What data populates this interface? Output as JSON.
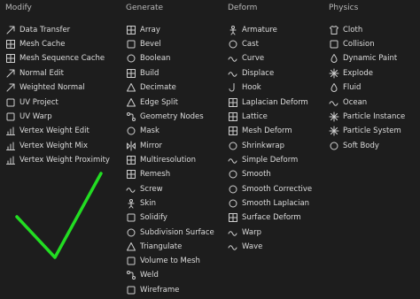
{
  "columns": [
    {
      "header": "Modify",
      "items": [
        {
          "label": "Data Transfer",
          "icon": "data-transfer-icon"
        },
        {
          "label": "Mesh Cache",
          "icon": "mesh-cache-icon"
        },
        {
          "label": "Mesh Sequence Cache",
          "icon": "mesh-sequence-cache-icon"
        },
        {
          "label": "Normal Edit",
          "icon": "normal-edit-icon"
        },
        {
          "label": "Weighted Normal",
          "icon": "weighted-normal-icon"
        },
        {
          "label": "UV Project",
          "icon": "uv-project-icon"
        },
        {
          "label": "UV Warp",
          "icon": "uv-warp-icon"
        },
        {
          "label": "Vertex Weight Edit",
          "icon": "vertex-weight-edit-icon"
        },
        {
          "label": "Vertex Weight Mix",
          "icon": "vertex-weight-mix-icon"
        },
        {
          "label": "Vertex Weight Proximity",
          "icon": "vertex-weight-proximity-icon"
        }
      ]
    },
    {
      "header": "Generate",
      "items": [
        {
          "label": "Array",
          "icon": "array-icon"
        },
        {
          "label": "Bevel",
          "icon": "bevel-icon"
        },
        {
          "label": "Boolean",
          "icon": "boolean-icon"
        },
        {
          "label": "Build",
          "icon": "build-icon"
        },
        {
          "label": "Decimate",
          "icon": "decimate-icon"
        },
        {
          "label": "Edge Split",
          "icon": "edge-split-icon"
        },
        {
          "label": "Geometry Nodes",
          "icon": "geometry-nodes-icon"
        },
        {
          "label": "Mask",
          "icon": "mask-icon"
        },
        {
          "label": "Mirror",
          "icon": "mirror-icon"
        },
        {
          "label": "Multiresolution",
          "icon": "multiresolution-icon"
        },
        {
          "label": "Remesh",
          "icon": "remesh-icon"
        },
        {
          "label": "Screw",
          "icon": "screw-icon"
        },
        {
          "label": "Skin",
          "icon": "skin-icon"
        },
        {
          "label": "Solidify",
          "icon": "solidify-icon"
        },
        {
          "label": "Subdivision Surface",
          "icon": "subdivision-surface-icon"
        },
        {
          "label": "Triangulate",
          "icon": "triangulate-icon"
        },
        {
          "label": "Volume to Mesh",
          "icon": "volume-to-mesh-icon"
        },
        {
          "label": "Weld",
          "icon": "weld-icon"
        },
        {
          "label": "Wireframe",
          "icon": "wireframe-icon"
        }
      ]
    },
    {
      "header": "Deform",
      "items": [
        {
          "label": "Armature",
          "icon": "armature-icon"
        },
        {
          "label": "Cast",
          "icon": "cast-icon"
        },
        {
          "label": "Curve",
          "icon": "curve-icon"
        },
        {
          "label": "Displace",
          "icon": "displace-icon"
        },
        {
          "label": "Hook",
          "icon": "hook-icon"
        },
        {
          "label": "Laplacian Deform",
          "icon": "laplacian-deform-icon"
        },
        {
          "label": "Lattice",
          "icon": "lattice-icon"
        },
        {
          "label": "Mesh Deform",
          "icon": "mesh-deform-icon"
        },
        {
          "label": "Shrinkwrap",
          "icon": "shrinkwrap-icon"
        },
        {
          "label": "Simple Deform",
          "icon": "simple-deform-icon"
        },
        {
          "label": "Smooth",
          "icon": "smooth-icon"
        },
        {
          "label": "Smooth Corrective",
          "icon": "smooth-corrective-icon"
        },
        {
          "label": "Smooth Laplacian",
          "icon": "smooth-laplacian-icon"
        },
        {
          "label": "Surface Deform",
          "icon": "surface-deform-icon"
        },
        {
          "label": "Warp",
          "icon": "warp-icon"
        },
        {
          "label": "Wave",
          "icon": "wave-icon"
        }
      ]
    },
    {
      "header": "Physics",
      "items": [
        {
          "label": "Cloth",
          "icon": "cloth-icon"
        },
        {
          "label": "Collision",
          "icon": "collision-icon"
        },
        {
          "label": "Dynamic Paint",
          "icon": "dynamic-paint-icon"
        },
        {
          "label": "Explode",
          "icon": "explode-icon"
        },
        {
          "label": "Fluid",
          "icon": "fluid-icon"
        },
        {
          "label": "Ocean",
          "icon": "ocean-icon"
        },
        {
          "label": "Particle Instance",
          "icon": "particle-instance-icon"
        },
        {
          "label": "Particle System",
          "icon": "particle-system-icon"
        },
        {
          "label": "Soft Body",
          "icon": "soft-body-icon"
        }
      ]
    }
  ],
  "colors": {
    "background": "#1d1d1d",
    "text": "#dcdcdc",
    "header_text": "#b8b8b8",
    "icon": "#cfcfcf",
    "checkmark": "#22dd22"
  },
  "annotation_icon": "green-checkmark-icon"
}
